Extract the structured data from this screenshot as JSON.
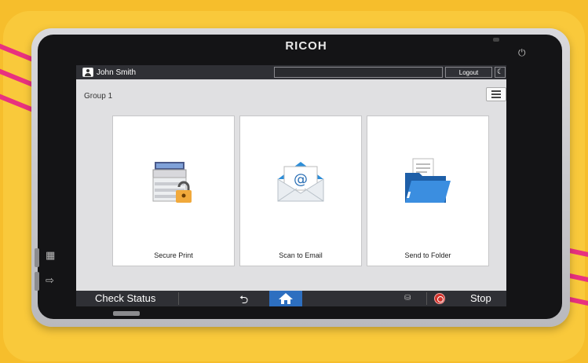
{
  "device": {
    "brand": "RICOH"
  },
  "header": {
    "user_name": "John Smith",
    "logout_label": "Logout"
  },
  "main": {
    "group_title": "Group 1",
    "tiles": [
      {
        "label": "Secure Print",
        "icon": "secure-print-icon"
      },
      {
        "label": "Scan to Email",
        "icon": "email-envelope-icon"
      },
      {
        "label": "Send to Folder",
        "icon": "folder-icon"
      }
    ]
  },
  "footer": {
    "check_status_label": "Check Status",
    "stop_label": "Stop"
  },
  "colors": {
    "background": "#f6be2c",
    "accent_stripes": "#e8327f",
    "bar": "#2f3035",
    "home_button": "#2d6fc0",
    "stop_button": "#d0342c"
  }
}
